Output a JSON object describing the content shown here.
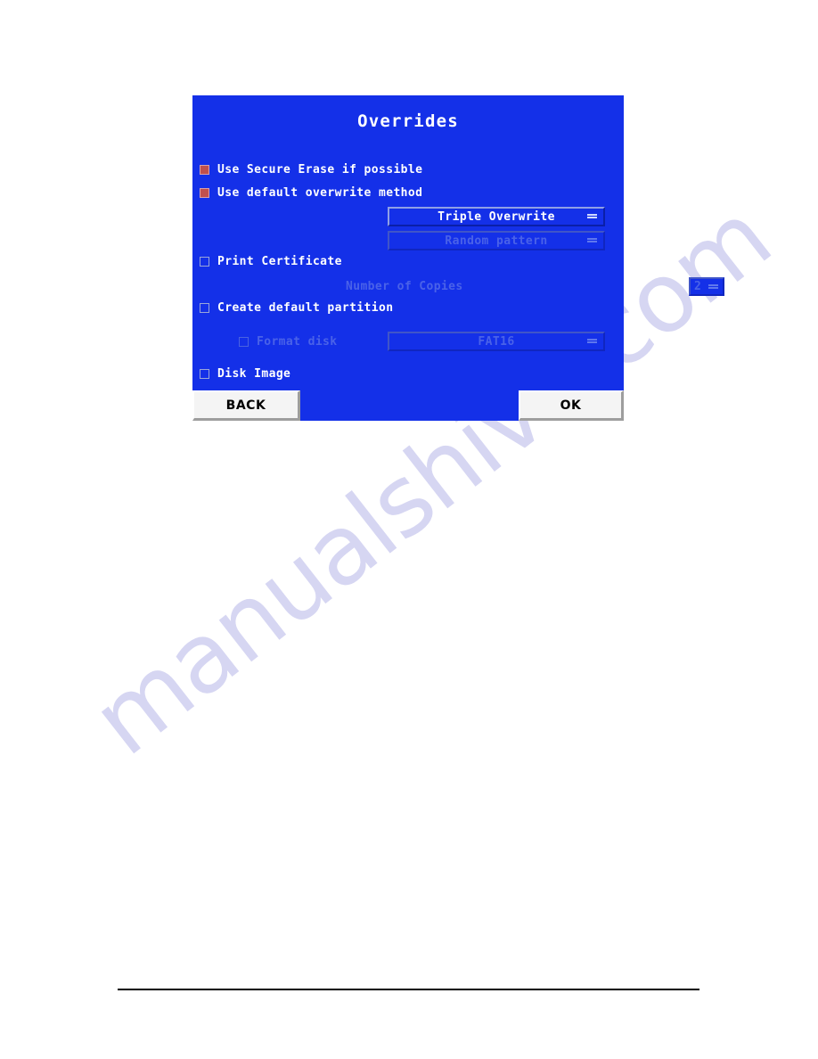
{
  "page": {
    "watermark": "manualshive.com"
  },
  "dialog": {
    "title": "Overrides",
    "colors": {
      "background": "#1430e8",
      "checked_checkbox": "#c0504d",
      "text": "#ffffff",
      "disabled_text": "#4a62e8",
      "button_face": "#f4f4f4"
    },
    "options": [
      {
        "label": "Use Secure Erase if possible",
        "checked": true,
        "enabled": true
      },
      {
        "label": "Use default overwrite method",
        "checked": true,
        "enabled": true
      },
      {
        "label": "Print Certificate",
        "checked": false,
        "enabled": true
      },
      {
        "label": "Create default partition",
        "checked": false,
        "enabled": true
      },
      {
        "label": "Format disk",
        "checked": false,
        "enabled": false
      },
      {
        "label": "Disk Image",
        "checked": false,
        "enabled": true
      }
    ],
    "dropdowns": [
      {
        "name": "overwrite-method",
        "value": "Triple Overwrite",
        "enabled": true,
        "arrow_icon": "chevron-down-icon"
      },
      {
        "name": "overwrite-pattern",
        "value": "Random pattern",
        "enabled": false,
        "arrow_icon": "chevron-down-icon"
      },
      {
        "name": "filesystem",
        "value": "FAT16",
        "enabled": false,
        "arrow_icon": "chevron-down-icon"
      }
    ],
    "copies": {
      "label": "Number of Copies",
      "value": "2",
      "enabled": false,
      "arrow_icon": "chevron-down-icon"
    },
    "buttons": {
      "back": "BACK",
      "ok": "OK"
    }
  }
}
